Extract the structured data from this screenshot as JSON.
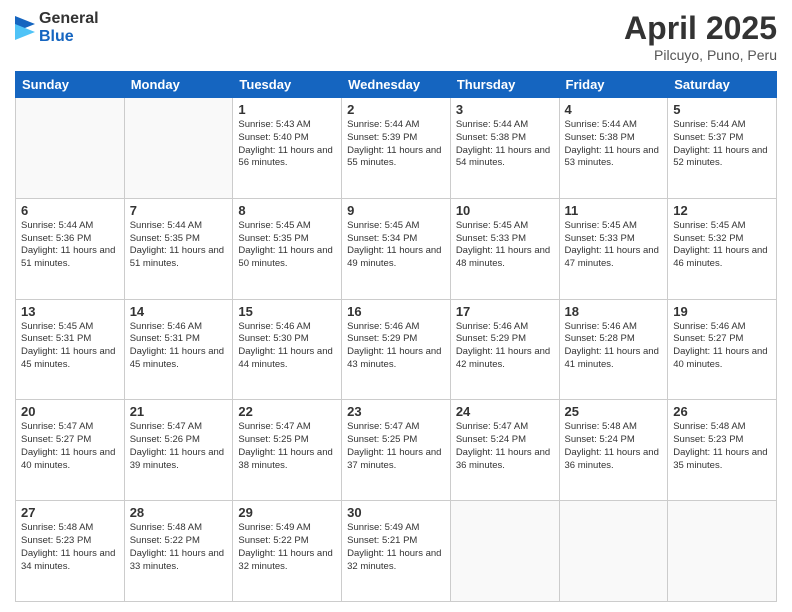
{
  "logo": {
    "general": "General",
    "blue": "Blue"
  },
  "title": "April 2025",
  "subtitle": "Pilcuyo, Puno, Peru",
  "weekdays": [
    "Sunday",
    "Monday",
    "Tuesday",
    "Wednesday",
    "Thursday",
    "Friday",
    "Saturday"
  ],
  "weeks": [
    [
      null,
      null,
      {
        "day": 1,
        "sunrise": "5:43 AM",
        "sunset": "5:40 PM",
        "daylight": "11 hours and 56 minutes."
      },
      {
        "day": 2,
        "sunrise": "5:44 AM",
        "sunset": "5:39 PM",
        "daylight": "11 hours and 55 minutes."
      },
      {
        "day": 3,
        "sunrise": "5:44 AM",
        "sunset": "5:38 PM",
        "daylight": "11 hours and 54 minutes."
      },
      {
        "day": 4,
        "sunrise": "5:44 AM",
        "sunset": "5:38 PM",
        "daylight": "11 hours and 53 minutes."
      },
      {
        "day": 5,
        "sunrise": "5:44 AM",
        "sunset": "5:37 PM",
        "daylight": "11 hours and 52 minutes."
      }
    ],
    [
      {
        "day": 6,
        "sunrise": "5:44 AM",
        "sunset": "5:36 PM",
        "daylight": "11 hours and 51 minutes."
      },
      {
        "day": 7,
        "sunrise": "5:44 AM",
        "sunset": "5:35 PM",
        "daylight": "11 hours and 51 minutes."
      },
      {
        "day": 8,
        "sunrise": "5:45 AM",
        "sunset": "5:35 PM",
        "daylight": "11 hours and 50 minutes."
      },
      {
        "day": 9,
        "sunrise": "5:45 AM",
        "sunset": "5:34 PM",
        "daylight": "11 hours and 49 minutes."
      },
      {
        "day": 10,
        "sunrise": "5:45 AM",
        "sunset": "5:33 PM",
        "daylight": "11 hours and 48 minutes."
      },
      {
        "day": 11,
        "sunrise": "5:45 AM",
        "sunset": "5:33 PM",
        "daylight": "11 hours and 47 minutes."
      },
      {
        "day": 12,
        "sunrise": "5:45 AM",
        "sunset": "5:32 PM",
        "daylight": "11 hours and 46 minutes."
      }
    ],
    [
      {
        "day": 13,
        "sunrise": "5:45 AM",
        "sunset": "5:31 PM",
        "daylight": "11 hours and 45 minutes."
      },
      {
        "day": 14,
        "sunrise": "5:46 AM",
        "sunset": "5:31 PM",
        "daylight": "11 hours and 45 minutes."
      },
      {
        "day": 15,
        "sunrise": "5:46 AM",
        "sunset": "5:30 PM",
        "daylight": "11 hours and 44 minutes."
      },
      {
        "day": 16,
        "sunrise": "5:46 AM",
        "sunset": "5:29 PM",
        "daylight": "11 hours and 43 minutes."
      },
      {
        "day": 17,
        "sunrise": "5:46 AM",
        "sunset": "5:29 PM",
        "daylight": "11 hours and 42 minutes."
      },
      {
        "day": 18,
        "sunrise": "5:46 AM",
        "sunset": "5:28 PM",
        "daylight": "11 hours and 41 minutes."
      },
      {
        "day": 19,
        "sunrise": "5:46 AM",
        "sunset": "5:27 PM",
        "daylight": "11 hours and 40 minutes."
      }
    ],
    [
      {
        "day": 20,
        "sunrise": "5:47 AM",
        "sunset": "5:27 PM",
        "daylight": "11 hours and 40 minutes."
      },
      {
        "day": 21,
        "sunrise": "5:47 AM",
        "sunset": "5:26 PM",
        "daylight": "11 hours and 39 minutes."
      },
      {
        "day": 22,
        "sunrise": "5:47 AM",
        "sunset": "5:25 PM",
        "daylight": "11 hours and 38 minutes."
      },
      {
        "day": 23,
        "sunrise": "5:47 AM",
        "sunset": "5:25 PM",
        "daylight": "11 hours and 37 minutes."
      },
      {
        "day": 24,
        "sunrise": "5:47 AM",
        "sunset": "5:24 PM",
        "daylight": "11 hours and 36 minutes."
      },
      {
        "day": 25,
        "sunrise": "5:48 AM",
        "sunset": "5:24 PM",
        "daylight": "11 hours and 36 minutes."
      },
      {
        "day": 26,
        "sunrise": "5:48 AM",
        "sunset": "5:23 PM",
        "daylight": "11 hours and 35 minutes."
      }
    ],
    [
      {
        "day": 27,
        "sunrise": "5:48 AM",
        "sunset": "5:23 PM",
        "daylight": "11 hours and 34 minutes."
      },
      {
        "day": 28,
        "sunrise": "5:48 AM",
        "sunset": "5:22 PM",
        "daylight": "11 hours and 33 minutes."
      },
      {
        "day": 29,
        "sunrise": "5:49 AM",
        "sunset": "5:22 PM",
        "daylight": "11 hours and 32 minutes."
      },
      {
        "day": 30,
        "sunrise": "5:49 AM",
        "sunset": "5:21 PM",
        "daylight": "11 hours and 32 minutes."
      },
      null,
      null,
      null
    ]
  ]
}
